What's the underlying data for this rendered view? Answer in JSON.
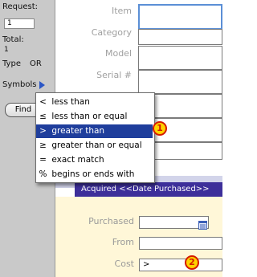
{
  "status": {
    "request_label": "Request:",
    "request_value": "1",
    "total_label": "Total:",
    "total_value": "1",
    "type_label": "Type",
    "type_value": "OR",
    "symbols_label": "Symbols",
    "find_label": "Find"
  },
  "form": {
    "item_label": "Item",
    "category_label": "Category",
    "model_label": "Model",
    "serial_label": "Serial #"
  },
  "section": {
    "header": "Acquired <<Date Purchased>>",
    "purchased_label": "Purchased",
    "from_label": "From",
    "cost_label": "Cost",
    "cost_value": ">"
  },
  "menu": {
    "items": [
      {
        "symbol": "<",
        "label": "less than"
      },
      {
        "symbol": "≤",
        "label": "less than or equal"
      },
      {
        "symbol": ">",
        "label": "greater than",
        "selected": true
      },
      {
        "symbol": "≥",
        "label": "greater than or equal"
      },
      {
        "symbol": "=",
        "label": "exact match"
      },
      {
        "symbol": "%",
        "label": "begins or ends with"
      }
    ]
  },
  "callouts": [
    "1",
    "2"
  ],
  "colors": {
    "menu_highlight": "#1f3e9c",
    "section_header": "#3d2f9a",
    "lower_background": "#fff7d8",
    "callout_fill": "#ffd200",
    "callout_border": "#d41a00"
  }
}
